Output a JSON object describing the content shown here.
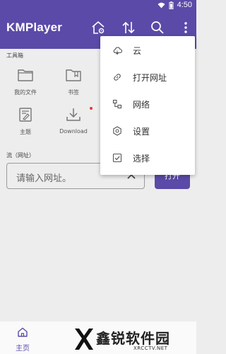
{
  "status": {
    "time": "4:50"
  },
  "header": {
    "title": "KMPlayer"
  },
  "toolbox": {
    "title": "工具箱",
    "items": [
      {
        "label": "我的文件",
        "icon": "folder-icon"
      },
      {
        "label": "书签",
        "icon": "bookmark-folder-icon"
      },
      {
        "label": "主题",
        "icon": "theme-icon"
      },
      {
        "label": "Download",
        "icon": "download-icon"
      }
    ]
  },
  "stream": {
    "title": "流（网址）",
    "placeholder": "请输入网址。",
    "open_label": "打开"
  },
  "menu": {
    "items": [
      {
        "label": "云",
        "icon": "cloud-icon"
      },
      {
        "label": "打开网址",
        "icon": "link-icon"
      },
      {
        "label": "网络",
        "icon": "network-icon"
      },
      {
        "label": "设置",
        "icon": "settings-gear-icon"
      },
      {
        "label": "选择",
        "icon": "checkbox-icon"
      }
    ]
  },
  "bottom_nav": {
    "home_label": "主页"
  },
  "watermark": {
    "text": "鑫锐软件园",
    "sub": "XRCCTV.NET"
  },
  "colors": {
    "accent": "#5b4aa8",
    "background": "#ededed",
    "notification_dot": "#e53935"
  }
}
